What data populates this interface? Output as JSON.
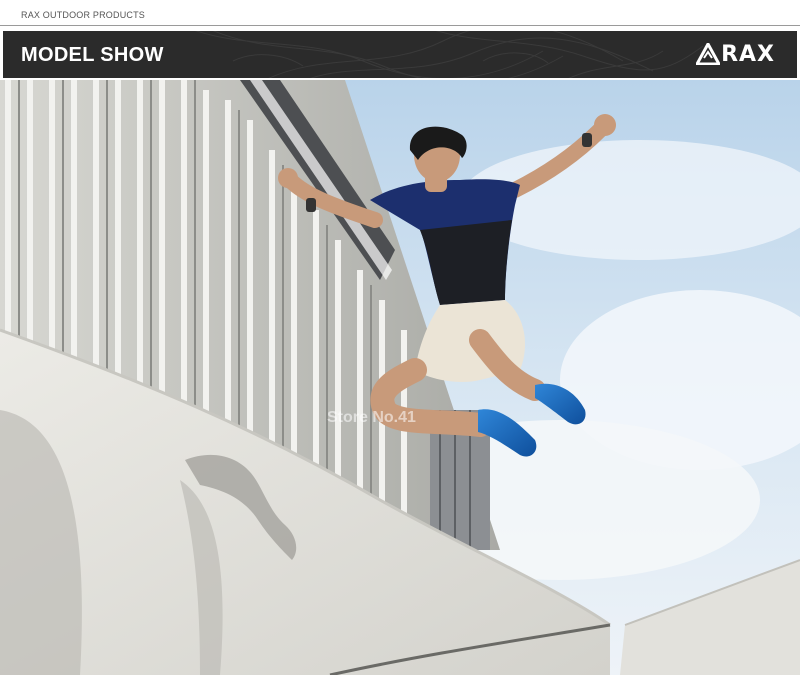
{
  "top_bar": {
    "label": "RAX OUTDOOR PRODUCTS"
  },
  "header": {
    "title": "MODEL SHOW",
    "brand": "RAX",
    "background_color": "#2b2b2b"
  },
  "photo": {
    "watermark": "Store No.41"
  }
}
